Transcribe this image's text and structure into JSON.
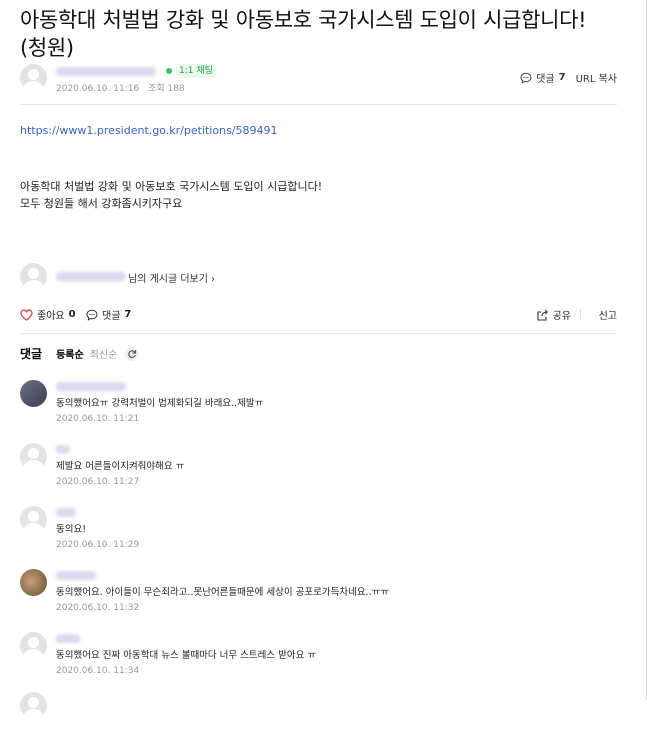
{
  "post": {
    "title": "아동학대 처벌법 강화 및 아동보호 국가시스템 도입이 시급합니다! (청원)",
    "chat_badge": "1:1 채팅",
    "date": "2020.06.10. 11:16",
    "views_label": "조회 188",
    "comment_label": "댓글",
    "comment_count": "7",
    "url_copy": "URL 복사",
    "link": "https://www1.president.go.kr/petitions/589491",
    "body_line1": "아동학대 처벌법 강화 및 아동보호 국가시스템 도입이 시급합니다!",
    "body_line2": "모두 청원들 해서 강화좀시키자구요",
    "more_posts": "님의 게시글 더보기 ›"
  },
  "actions": {
    "like_label": "좋아요",
    "like_count": "0",
    "comment_label": "댓글",
    "comment_count": "7",
    "share_label": "공유",
    "report_label": "신고"
  },
  "comments_header": {
    "title": "댓글",
    "sort_registered": "등록순",
    "sort_latest": "최신순"
  },
  "comments": [
    {
      "text": "동의했어요ㅠ 강력처벌이 법제화되길 바래요..제발ㅠ",
      "date": "2020.06.10. 11:21"
    },
    {
      "text": "제발요 어른들이지켜줘야해요 ㅠ",
      "date": "2020.06.10. 11:27"
    },
    {
      "text": "동의요!",
      "date": "2020.06.10. 11:29"
    },
    {
      "text": "동의했어요. 아이들이 무슨죄라고..못난어른들때문에 세상이 공포로가득차네요..ㅠㅠ",
      "date": "2020.06.10. 11:32"
    },
    {
      "text": "동의했어요 진짜 아동학대 뉴스 볼때마다 너무 스트레스 받아요 ㅠ",
      "date": "2020.06.10. 11:34"
    }
  ],
  "colors": {
    "link": "#3a63c8",
    "chat_green": "#1f9d48",
    "muted": "#999999",
    "like_heart": "#e03a3a"
  },
  "icons": [
    "chat-bubble-icon",
    "heart-icon",
    "comment-icon",
    "share-icon",
    "refresh-icon",
    "avatar-icon",
    "chat-online-dot-icon"
  ]
}
